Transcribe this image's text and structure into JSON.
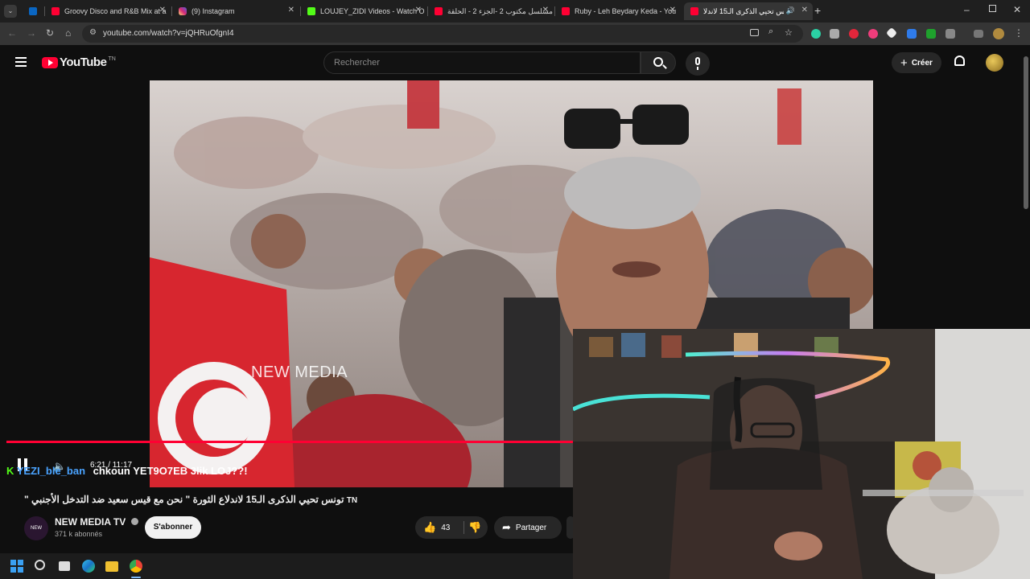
{
  "browser": {
    "tabs": [
      {
        "label": "",
        "site": "linkedin",
        "color": "#0a66c2"
      },
      {
        "label": "Groovy Disco and R&B Mix at a",
        "site": "youtube",
        "color": "#ff0033"
      },
      {
        "label": "(9) Instagram",
        "site": "instagram",
        "color": "#d6249f"
      },
      {
        "label": "LOUJEY_ZIDI Videos - Watch O",
        "site": "kick",
        "color": "#53fc18"
      },
      {
        "label": "مسلسل مكتوب 2 -الجزء 2 - الحلقة",
        "site": "youtube",
        "color": "#ff0033"
      },
      {
        "label": "Ruby - Leh Beydary Keda - You",
        "site": "youtube",
        "color": "#ff0033"
      },
      {
        "label": "تونس تحيي الذكرى الـ15 لاندلا",
        "site": "youtube",
        "color": "#ff0033",
        "active": true
      }
    ],
    "url": "youtube.com/watch?v=jQHRuOfgnI4"
  },
  "youtube": {
    "logo": "YouTube",
    "country_code": "TN",
    "search_placeholder": "Rechercher",
    "create_label": "Créer"
  },
  "video": {
    "watermark": "NEW MEDIA",
    "time": "6:21 / 11:17",
    "progress_fraction": 0.56,
    "chat_user": "YEZI_ble_ban",
    "chat_message": "chkoun YET9O7EB 3lik LOJ??!",
    "title": "تونس تحيي الذكرى الـ15 لاندلاع الثورة \" نحن مع قيس سعيد ضد التدخل الأجنبي \"",
    "title_flag": "TN",
    "channel_name": "NEW MEDIA TV",
    "subscribers": "371 k abonnés",
    "subscribe_label": "S'abonner",
    "likes": "43",
    "share_label": "Partager"
  },
  "colors": {
    "accent": "#ff0033",
    "chat_user": "#4aa3ff"
  }
}
